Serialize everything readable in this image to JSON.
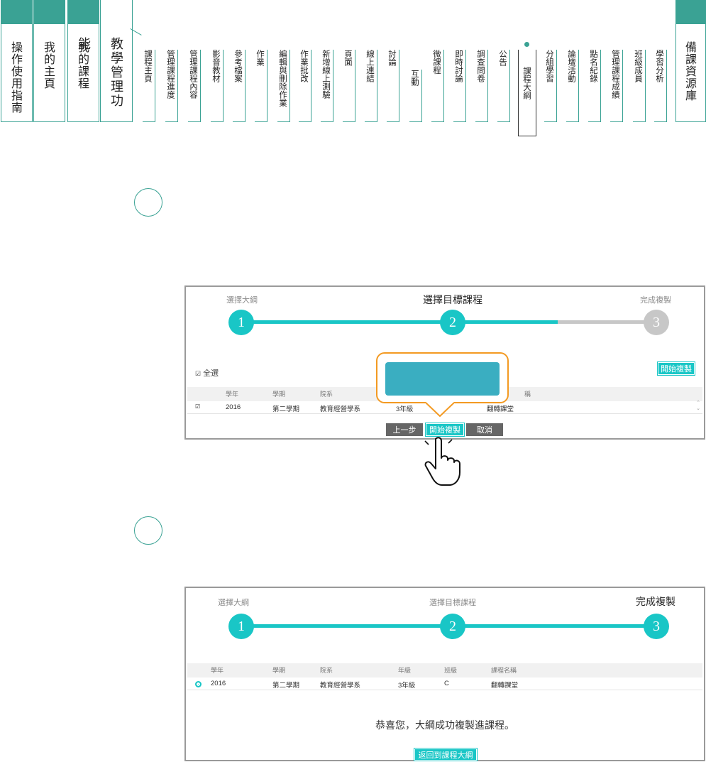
{
  "nav": {
    "main_tabs": [
      "操作使用指南",
      "我的主頁",
      "我的課程"
    ],
    "manage_tab": "教學管理功能",
    "sub_tabs": [
      "課程主頁",
      "管理課程進度",
      "管理課程內容",
      "影音教材",
      "參考檔案",
      "作業",
      "編輯與刪除作業",
      "作業批改",
      "新增線上測驗",
      "頁面",
      "線上連結",
      "討論",
      "互動",
      "微課程",
      "即時討論",
      "調查問卷",
      "公告",
      "課程大綱",
      "分組學習",
      "論壇活動",
      "點名紀錄",
      "管理課程成績",
      "班級成員",
      "學習分析"
    ],
    "active_sub_tab": "課程大綱",
    "resource_tab": "備課資源庫",
    "accent_color": "#3aa294"
  },
  "panel1": {
    "steps": [
      "選擇大綱",
      "選擇目標課程",
      "完成複製"
    ],
    "step_numbers": [
      "1",
      "2",
      "3"
    ],
    "select_all": "全選",
    "start_copy_top": "開始複製",
    "columns": [
      "學年",
      "學期",
      "院系",
      "",
      "",
      "稱"
    ],
    "row": [
      "2016",
      "第二學期",
      "教育經營學系",
      "3年級",
      "翻轉課堂"
    ],
    "buttons": {
      "prev": "上一步",
      "start": "開始複製",
      "cancel": "取消"
    },
    "accent_color": "#19c6c6"
  },
  "panel2": {
    "steps": [
      "選擇大綱",
      "選擇目標課程",
      "完成複製"
    ],
    "step_numbers": [
      "1",
      "2",
      "3"
    ],
    "columns": [
      "學年",
      "學期",
      "院系",
      "年級",
      "班級",
      "課程名稱"
    ],
    "row": [
      "2016",
      "第二學期",
      "教育經營學系",
      "3年級",
      "C",
      "翻轉課堂"
    ],
    "success_message": "恭喜您，大綱成功複製進課程。",
    "return_button": "返回到課程大綱"
  },
  "callout_color": "#f39a22"
}
